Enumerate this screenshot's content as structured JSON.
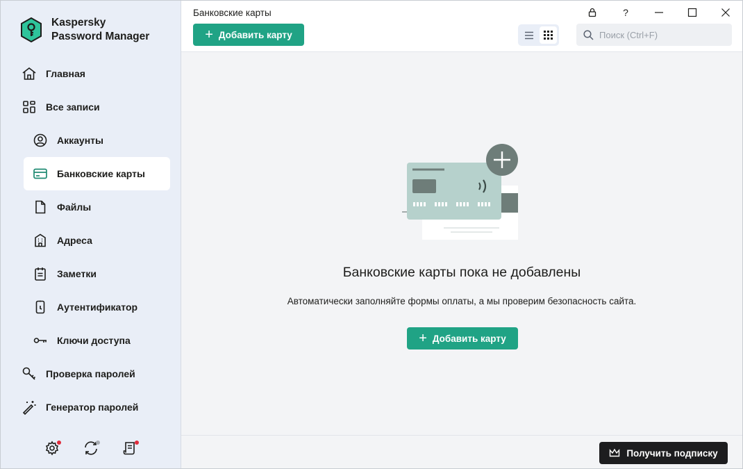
{
  "app": {
    "brand_line1": "Kaspersky",
    "brand_line2": "Password Manager"
  },
  "sidebar": {
    "items": [
      {
        "label": "Главная",
        "icon": "home-icon"
      },
      {
        "label": "Все записи",
        "icon": "grid-icon"
      },
      {
        "label": "Аккаунты",
        "icon": "user-circle-icon"
      },
      {
        "label": "Банковские карты",
        "icon": "credit-card-icon",
        "active": true
      },
      {
        "label": "Файлы",
        "icon": "file-icon"
      },
      {
        "label": "Адреса",
        "icon": "building-icon"
      },
      {
        "label": "Заметки",
        "icon": "notepad-icon"
      },
      {
        "label": "Аутентификатор",
        "icon": "phone-icon"
      },
      {
        "label": "Ключи доступа",
        "icon": "key-icon"
      },
      {
        "label": "Проверка паролей",
        "icon": "key-check-icon"
      },
      {
        "label": "Генератор паролей",
        "icon": "magic-wand-icon"
      }
    ],
    "footer": [
      {
        "icon": "gear-icon",
        "dot_color": "#e02d3c"
      },
      {
        "icon": "sync-icon",
        "dot_color": "#a8adb4"
      },
      {
        "icon": "news-icon",
        "dot_color": "#e02d3c"
      }
    ]
  },
  "header": {
    "title": "Банковские карты",
    "add_button": "Добавить карту",
    "search_placeholder": "Поиск (Ctrl+F)",
    "window_controls": [
      "lock-icon",
      "help-icon",
      "minimize-icon",
      "maximize-icon",
      "close-icon"
    ],
    "help_label": "?"
  },
  "empty_state": {
    "title": "Банковские карты пока не добавлены",
    "description": "Автоматически заполняйте формы оплаты, а мы проверим безопасность сайта.",
    "add_button": "Добавить карту"
  },
  "footer": {
    "subscribe_button": "Получить подписку"
  },
  "colors": {
    "accent": "#20a385",
    "sidebar_bg": "#e9eef7",
    "main_bg": "#f3f4f6",
    "dark_button": "#1d1d1f"
  }
}
